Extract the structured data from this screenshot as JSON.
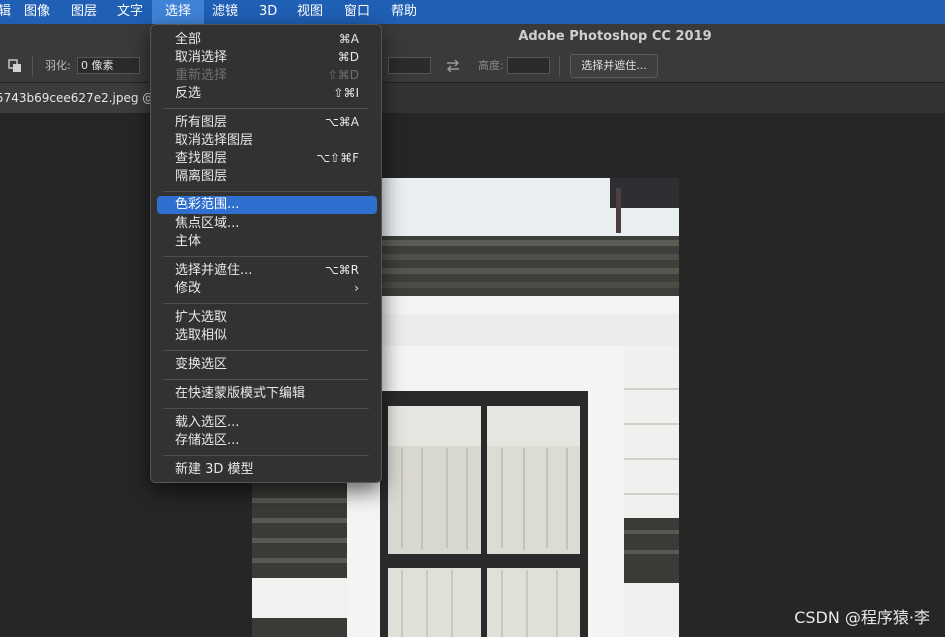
{
  "menubar": {
    "items": [
      "辑",
      "图像",
      "图层",
      "文字",
      "选择",
      "滤镜",
      "3D",
      "视图",
      "窗口",
      "帮助"
    ],
    "active_index": 4
  },
  "app": {
    "title": "Adobe Photoshop CC 2019"
  },
  "options_bar": {
    "feather_label": "羽化:",
    "feather_value": "0 像素",
    "height_label": "高度:",
    "select_and_mask": "选择并遮住..."
  },
  "document": {
    "tab_label": "5743b69cee627e2.jpeg @"
  },
  "select_menu": {
    "items": [
      {
        "label": "全部",
        "shortcut": "⌘A",
        "disabled": false,
        "highlighted": false
      },
      {
        "label": "取消选择",
        "shortcut": "⌘D",
        "disabled": false,
        "highlighted": false
      },
      {
        "label": "重新选择",
        "shortcut": "⇧⌘D",
        "disabled": true,
        "highlighted": false
      },
      {
        "label": "反选",
        "shortcut": "⇧⌘I",
        "disabled": false,
        "highlighted": false
      },
      {
        "label": "所有图层",
        "shortcut": "⌥⌘A",
        "disabled": false,
        "highlighted": false
      },
      {
        "label": "取消选择图层",
        "shortcut": "",
        "disabled": false,
        "highlighted": false
      },
      {
        "label": "查找图层",
        "shortcut": "⌥⇧⌘F",
        "disabled": false,
        "highlighted": false
      },
      {
        "label": "隔离图层",
        "shortcut": "",
        "disabled": false,
        "highlighted": false
      },
      {
        "label": "色彩范围...",
        "shortcut": "",
        "disabled": false,
        "highlighted": true
      },
      {
        "label": "焦点区域...",
        "shortcut": "",
        "disabled": false,
        "highlighted": false
      },
      {
        "label": "主体",
        "shortcut": "",
        "disabled": false,
        "highlighted": false
      },
      {
        "label": "选择并遮住...",
        "shortcut": "⌥⌘R",
        "disabled": false,
        "highlighted": false
      },
      {
        "label": "修改",
        "shortcut": "›",
        "disabled": false,
        "highlighted": false
      },
      {
        "label": "扩大选取",
        "shortcut": "",
        "disabled": false,
        "highlighted": false
      },
      {
        "label": "选取相似",
        "shortcut": "",
        "disabled": false,
        "highlighted": false
      },
      {
        "label": "变换选区",
        "shortcut": "",
        "disabled": false,
        "highlighted": false
      },
      {
        "label": "在快速蒙版模式下编辑",
        "shortcut": "",
        "disabled": false,
        "highlighted": false
      },
      {
        "label": "载入选区...",
        "shortcut": "",
        "disabled": false,
        "highlighted": false
      },
      {
        "label": "存储选区...",
        "shortcut": "",
        "disabled": false,
        "highlighted": false
      },
      {
        "label": "新建 3D 模型",
        "shortcut": "",
        "disabled": false,
        "highlighted": false
      }
    ]
  },
  "watermark": "CSDN @程序猿·李",
  "colors": {
    "menubar_bg": "#1f5fb4",
    "menu_highlight": "#2f6fd0",
    "panel_bg": "#3a3a3a",
    "canvas_bg": "#262626"
  }
}
